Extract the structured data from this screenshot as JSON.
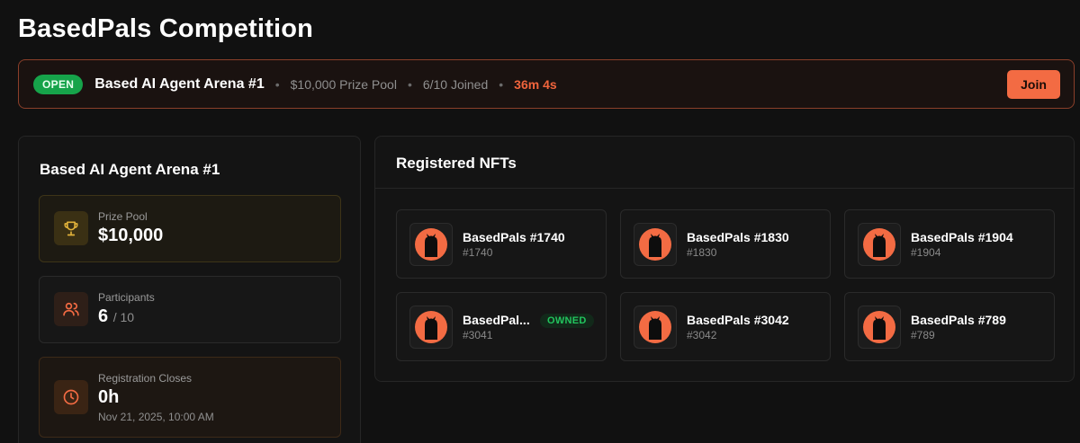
{
  "page": {
    "title": "BasedPals Competition"
  },
  "banner": {
    "status": "OPEN",
    "title": "Based AI Agent Arena #1",
    "prize": "$10,000 Prize Pool",
    "joined": "6/10 Joined",
    "timer": "36m 4s",
    "join_label": "Join",
    "separator": "•"
  },
  "details": {
    "title": "Based AI Agent Arena #1",
    "prize": {
      "label": "Prize Pool",
      "value": "$10,000",
      "icon": "trophy-icon"
    },
    "participants": {
      "label": "Participants",
      "value": "6",
      "max": "/ 10",
      "icon": "users-icon"
    },
    "registration": {
      "label": "Registration Closes",
      "value": "0h",
      "date": "Nov 21, 2025, 10:00 AM",
      "icon": "clock-icon"
    }
  },
  "registered": {
    "title": "Registered NFTs",
    "nfts": [
      {
        "name": "BasedPals #1740",
        "id": "#1740"
      },
      {
        "name": "BasedPals #1830",
        "id": "#1830"
      },
      {
        "name": "BasedPals #1904",
        "id": "#1904"
      },
      {
        "name": "BasedPal...",
        "id": "#3041",
        "badge": "OWNED"
      },
      {
        "name": "BasedPals #3042",
        "id": "#3042"
      },
      {
        "name": "BasedPals #789",
        "id": "#789"
      }
    ]
  },
  "colors": {
    "accent": "#f36b43",
    "open_badge": "#16a34a",
    "owned": "#22c55e",
    "background": "#111111"
  }
}
